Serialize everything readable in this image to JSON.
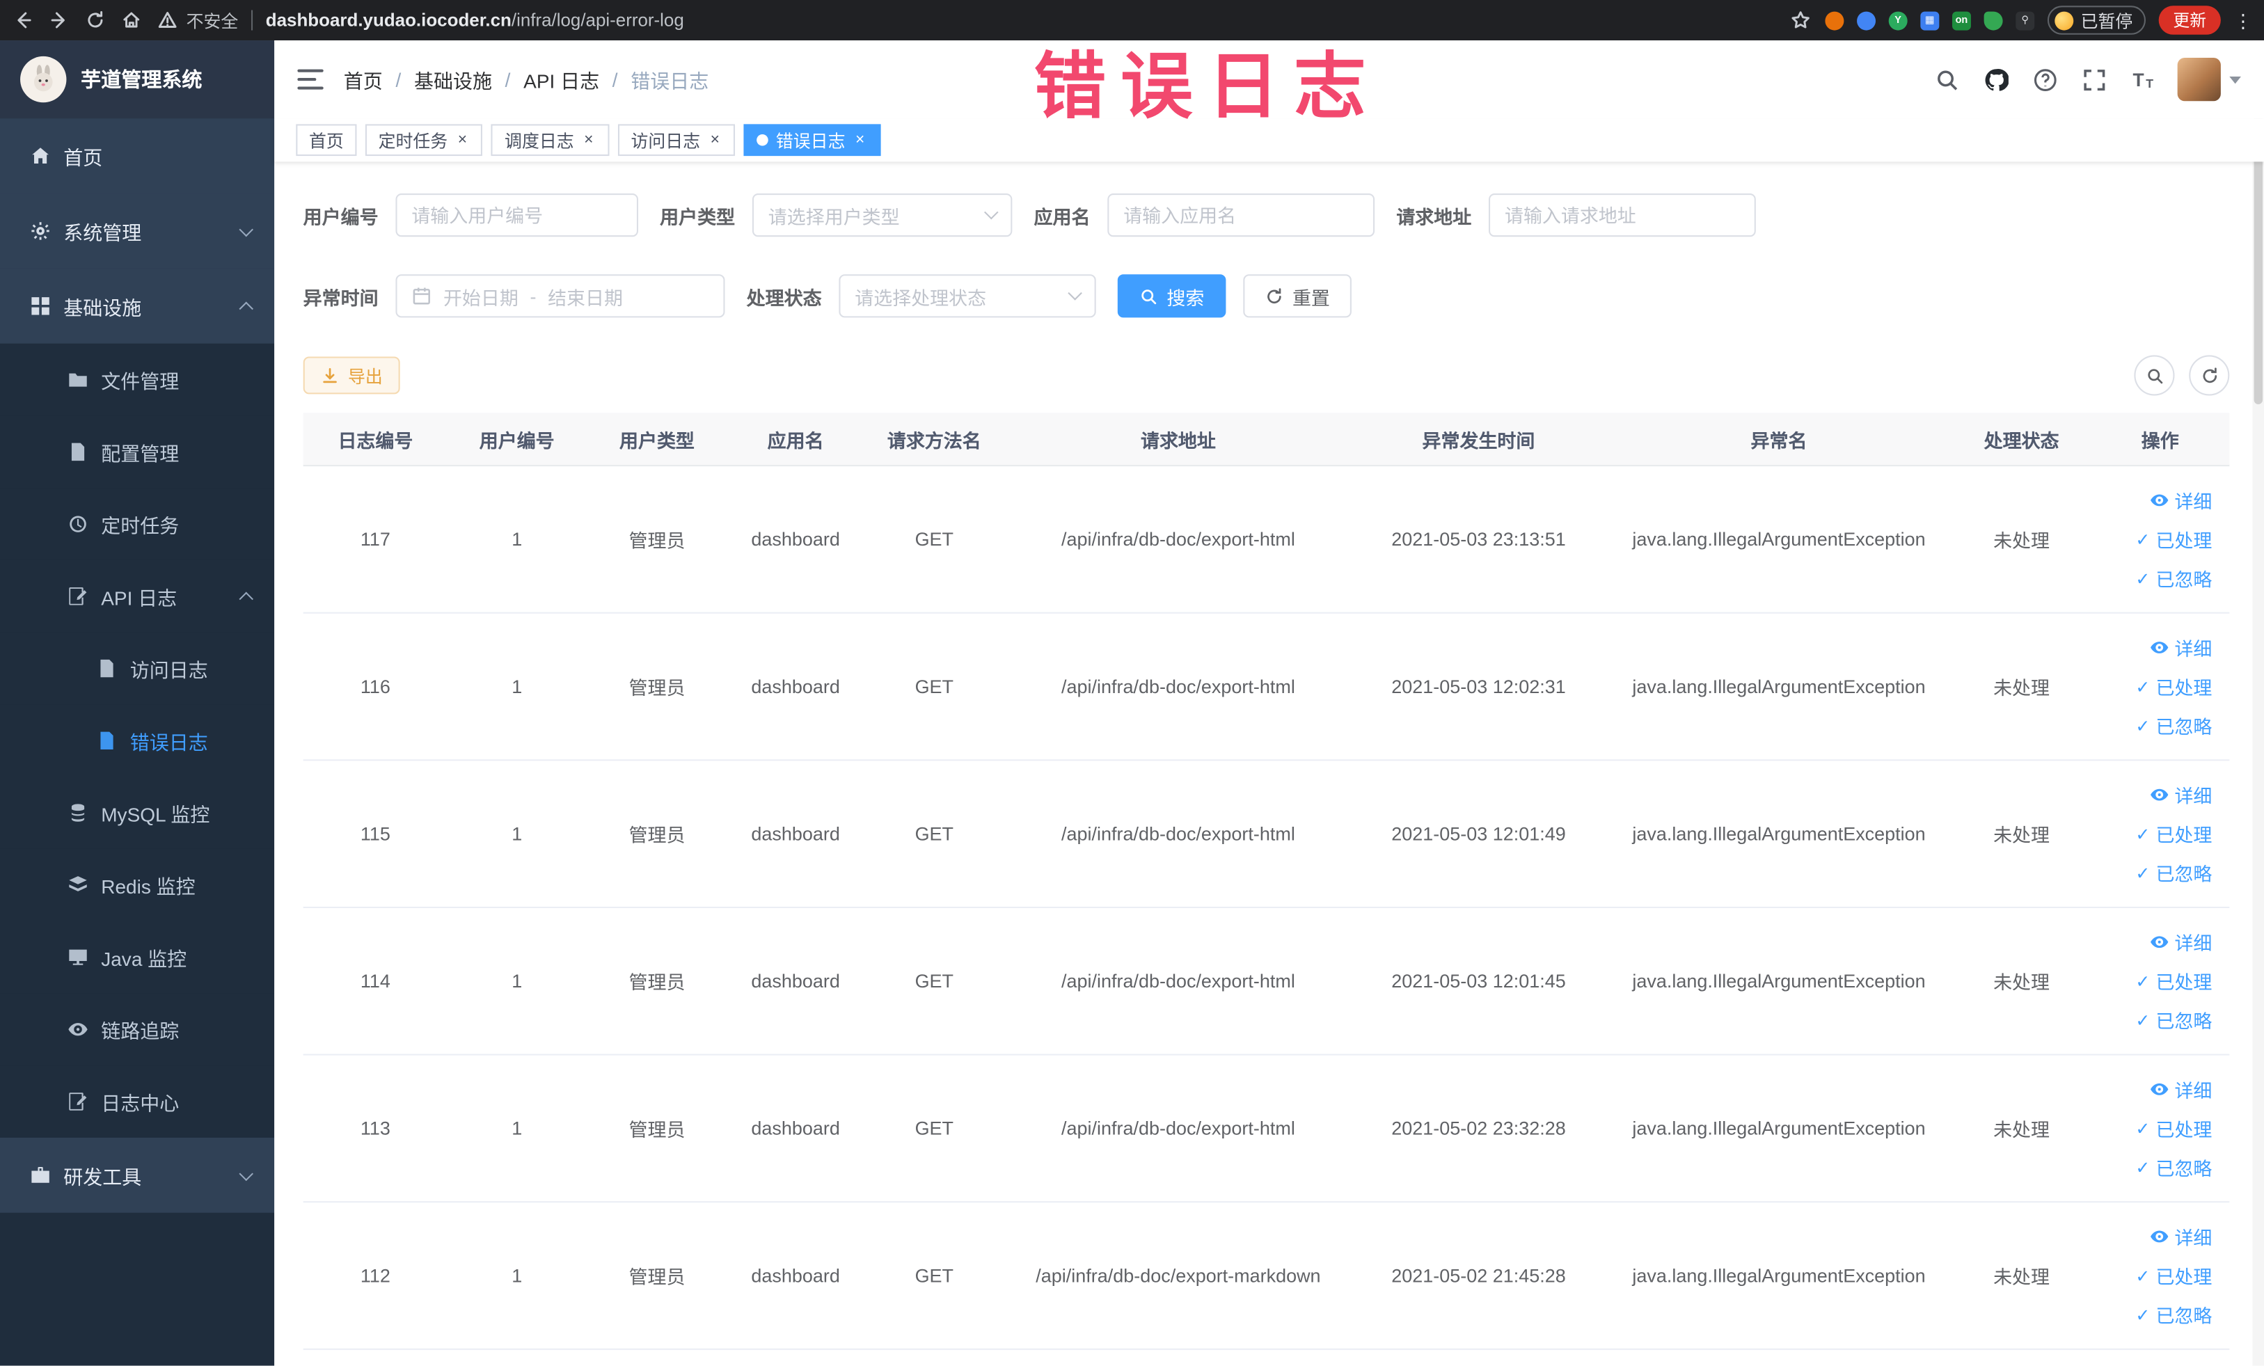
{
  "browser": {
    "security_label": "不安全",
    "url_host": "dashboard.yudao.iocoder.cn",
    "url_path": "/infra/log/api-error-log",
    "on_badge": "on",
    "paused_badge": "已暂停",
    "update_button": "更新"
  },
  "sidebar": {
    "logo_title": "芋道管理系统",
    "items": [
      {
        "label": "首页",
        "icon": "home-icon",
        "level": 1
      },
      {
        "label": "系统管理",
        "icon": "gear-icon",
        "level": 1,
        "chevron": "down"
      },
      {
        "label": "基础设施",
        "icon": "infra-icon",
        "level": 1,
        "chevron": "up"
      },
      {
        "label": "文件管理",
        "icon": "folder-icon",
        "level": 2
      },
      {
        "label": "配置管理",
        "icon": "config-icon",
        "level": 2
      },
      {
        "label": "定时任务",
        "icon": "timer-icon",
        "level": 2
      },
      {
        "label": "API 日志",
        "icon": "edit-doc-icon",
        "level": 2,
        "chevron": "up"
      },
      {
        "label": "访问日志",
        "icon": "doc-icon",
        "level": 3
      },
      {
        "label": "错误日志",
        "icon": "doc-icon",
        "level": 3,
        "active": true
      },
      {
        "label": "MySQL 监控",
        "icon": "database-icon",
        "level": 2
      },
      {
        "label": "Redis 监控",
        "icon": "layers-icon",
        "level": 2
      },
      {
        "label": "Java 监控",
        "icon": "monitor-icon",
        "level": 2
      },
      {
        "label": "链路追踪",
        "icon": "eye-icon",
        "level": 2
      },
      {
        "label": "日志中心",
        "icon": "edit-doc-icon",
        "level": 2
      },
      {
        "label": "研发工具",
        "icon": "tools-icon",
        "level": 1,
        "chevron": "down"
      }
    ]
  },
  "header": {
    "breadcrumb": [
      "首页",
      "基础设施",
      "API 日志",
      "错误日志"
    ],
    "watermark": "错误日志"
  },
  "tabs": [
    {
      "label": "首页",
      "closable": false,
      "active": false
    },
    {
      "label": "定时任务",
      "closable": true,
      "active": false
    },
    {
      "label": "调度日志",
      "closable": true,
      "active": false
    },
    {
      "label": "访问日志",
      "closable": true,
      "active": false
    },
    {
      "label": "错误日志",
      "closable": true,
      "active": true
    }
  ],
  "filters": {
    "user_id": {
      "label": "用户编号",
      "placeholder": "请输入用户编号"
    },
    "user_type": {
      "label": "用户类型",
      "placeholder": "请选择用户类型"
    },
    "app_name": {
      "label": "应用名",
      "placeholder": "请输入应用名"
    },
    "request_url": {
      "label": "请求地址",
      "placeholder": "请输入请求地址"
    },
    "exception_time": {
      "label": "异常时间",
      "start_placeholder": "开始日期",
      "separator": "-",
      "end_placeholder": "结束日期"
    },
    "process_status": {
      "label": "处理状态",
      "placeholder": "请选择处理状态"
    },
    "search_button": "搜索",
    "reset_button": "重置"
  },
  "toolbar": {
    "export_button": "导出"
  },
  "table": {
    "columns": [
      "日志编号",
      "用户编号",
      "用户类型",
      "应用名",
      "请求方法名",
      "请求地址",
      "异常发生时间",
      "异常名",
      "处理状态",
      "操作"
    ],
    "action_labels": [
      "详细",
      "已处理",
      "已忽略"
    ],
    "rows": [
      {
        "id": "117",
        "user_id": "1",
        "user_type": "管理员",
        "app": "dashboard",
        "method": "GET",
        "url": "/api/infra/db-doc/export-html",
        "time": "2021-05-03 23:13:51",
        "exception": "java.lang.IllegalArgumentException",
        "status": "未处理"
      },
      {
        "id": "116",
        "user_id": "1",
        "user_type": "管理员",
        "app": "dashboard",
        "method": "GET",
        "url": "/api/infra/db-doc/export-html",
        "time": "2021-05-03 12:02:31",
        "exception": "java.lang.IllegalArgumentException",
        "status": "未处理"
      },
      {
        "id": "115",
        "user_id": "1",
        "user_type": "管理员",
        "app": "dashboard",
        "method": "GET",
        "url": "/api/infra/db-doc/export-html",
        "time": "2021-05-03 12:01:49",
        "exception": "java.lang.IllegalArgumentException",
        "status": "未处理"
      },
      {
        "id": "114",
        "user_id": "1",
        "user_type": "管理员",
        "app": "dashboard",
        "method": "GET",
        "url": "/api/infra/db-doc/export-html",
        "time": "2021-05-03 12:01:45",
        "exception": "java.lang.IllegalArgumentException",
        "status": "未处理"
      },
      {
        "id": "113",
        "user_id": "1",
        "user_type": "管理员",
        "app": "dashboard",
        "method": "GET",
        "url": "/api/infra/db-doc/export-html",
        "time": "2021-05-02 23:32:28",
        "exception": "java.lang.IllegalArgumentException",
        "status": "未处理"
      },
      {
        "id": "112",
        "user_id": "1",
        "user_type": "管理员",
        "app": "dashboard",
        "method": "GET",
        "url": "/api/infra/db-doc/export-markdown",
        "time": "2021-05-02 21:45:28",
        "exception": "java.lang.IllegalArgumentException",
        "status": "未处理"
      }
    ]
  },
  "colors": {
    "accent": "#409eff",
    "warning": "#e6a23c",
    "watermark": "#f2486e",
    "sidebar": "#304156",
    "submenu": "#1f2d3d"
  }
}
